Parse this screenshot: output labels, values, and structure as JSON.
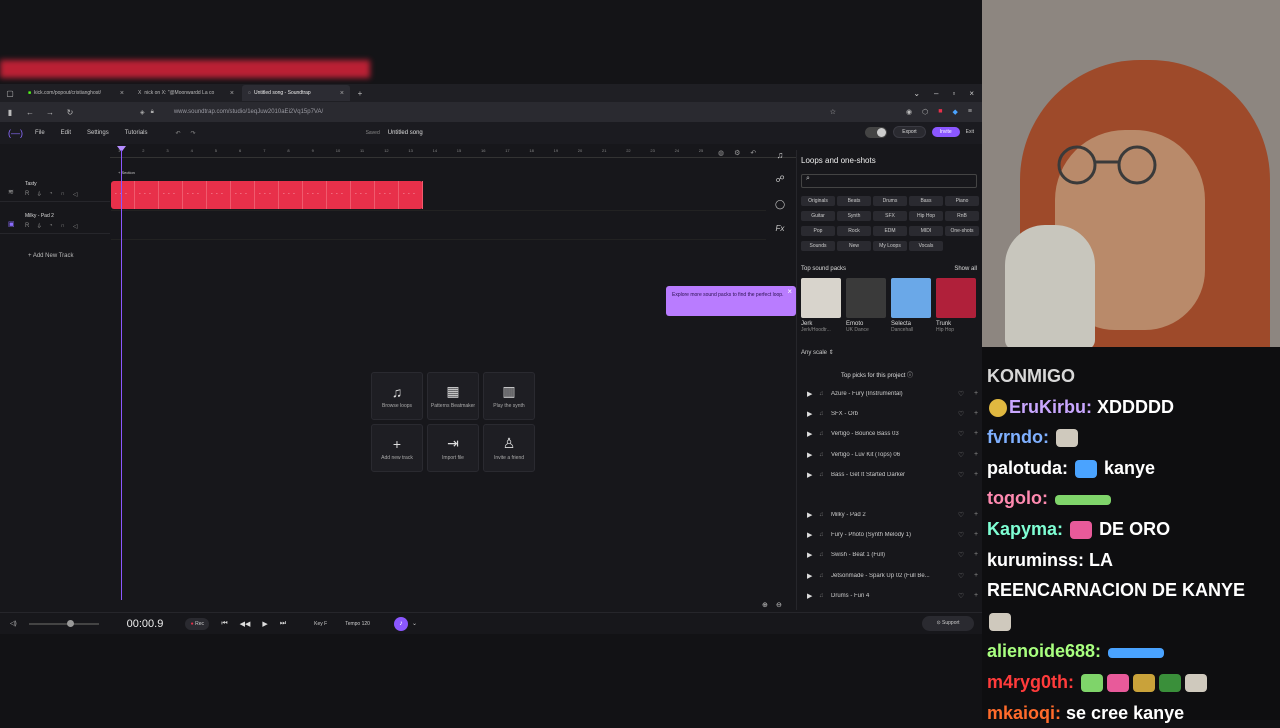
{
  "browser": {
    "tabs": [
      {
        "label": "kick.com/popout/cristianghost/",
        "active": false
      },
      {
        "label": "nick on X: \"@Moonwardd La co",
        "active": false
      },
      {
        "label": "Untitled song - Soundtrap",
        "active": true
      }
    ],
    "url": "www.soundtrap.com/studio/1eqJuw2010aEi2Vq15p7VA/"
  },
  "app": {
    "menu": [
      "File",
      "Edit",
      "Settings",
      "Tutorials"
    ],
    "saved_label": "Saved",
    "song_title": "Untitled song",
    "export_label": "Export",
    "invite_label": "Invite",
    "exit_label": "Exit"
  },
  "tracks": [
    {
      "name": "Tasty"
    },
    {
      "name": "Milky - Pad 2"
    }
  ],
  "add_track_label": "+ Add New Track",
  "section_label": "+ Section",
  "ruler_ticks": [
    "1",
    "2",
    "3",
    "4",
    "5",
    "6",
    "7",
    "8",
    "9",
    "10",
    "11",
    "12",
    "13",
    "14",
    "15",
    "16",
    "17",
    "18",
    "19",
    "20",
    "21",
    "22",
    "23",
    "24",
    "25"
  ],
  "empty_actions": [
    {
      "icon": "♫",
      "label": "Browse loops"
    },
    {
      "icon": "▦",
      "label": "Patterns Beatmaker"
    },
    {
      "icon": "▥",
      "label": "Play the synth"
    },
    {
      "icon": "+",
      "label": "Add new track"
    },
    {
      "icon": "⇥",
      "label": "Import file"
    },
    {
      "icon": "♙",
      "label": "Invite a friend"
    }
  ],
  "tooltip": {
    "text": "Explore more sound packs to find the perfect loop."
  },
  "loops": {
    "title": "Loops and one-shots",
    "search_placeholder": "",
    "filters": [
      "Originals",
      "Beats",
      "Drums",
      "Bass",
      "Piano",
      "Guitar",
      "Synth",
      "SFX",
      "Hip Hop",
      "RnB",
      "Pop",
      "Rock",
      "EDM",
      "MIDI",
      "One-shots",
      "Sounds",
      "New",
      "My Loops",
      "Vocals"
    ],
    "top_packs_label": "Top sound packs",
    "show_all_label": "Show all",
    "packs": [
      {
        "name": "Jerk",
        "genre": "Jerk/Hoodtr...",
        "color": "#d8d4cc"
      },
      {
        "name": "Emoto",
        "genre": "UK Dance",
        "color": "#3a3a3a"
      },
      {
        "name": "Selecta",
        "genre": "Dancehall",
        "color": "#6aa8e8"
      },
      {
        "name": "Trunk",
        "genre": "Hip Hop",
        "color": "#b0203a"
      }
    ],
    "any_scale_label": "Any scale",
    "top_picks_label": "Top picks for this project",
    "picks": [
      "Azure - Fury (Instrumental)",
      "SFX - Orb",
      "Vertigo - Bounce Bass 03",
      "Vertigo - Luv Kit (Tops) 06",
      "Bass - Get It Started Darker",
      "Milky - Pad 2",
      "Fury - Photo (Synth Melody 1)",
      "Swish - Beat 1 (Full)",
      "Jetsonmade - Spark Up 02 (Full Be...",
      "Drums - Fun 4"
    ]
  },
  "transport": {
    "time": "00:00.9",
    "rec_label": "Rec",
    "key_label": "Key F",
    "tempo_label": "Tempo 120",
    "support_label": "Support"
  },
  "chat": {
    "messages": [
      {
        "user": "KONMIGO",
        "color": "#d8d8d8",
        "text": "",
        "emotes": 0,
        "header": true
      },
      {
        "user": "EruKirbu:",
        "color": "#c9a7ff",
        "text": "XDDDDD",
        "emotes": 0,
        "badge": true
      },
      {
        "user": "fvrndo:",
        "color": "#7fb0ff",
        "text": "",
        "emotes": 1
      },
      {
        "user": "palotuda:",
        "color": "#ffffff",
        "text": "kanye",
        "emotes": 1
      },
      {
        "user": "togolo:",
        "color": "#ff8ab0",
        "text": "",
        "emotes": 1
      },
      {
        "user": "Kapyma:",
        "color": "#7fffd4",
        "text": "DE ORO",
        "emotes": 1
      },
      {
        "user": "kuruminss:",
        "color": "#ffffff",
        "text": "LA",
        "emotes": 0
      },
      {
        "user": "",
        "color": "#ffffff",
        "text": "REENCARNACION DE KANYE",
        "emotes": 0
      },
      {
        "user": "",
        "color": "#ffffff",
        "text": "",
        "emotes": 1
      },
      {
        "user": "alienoide688:",
        "color": "#a8ff7f",
        "text": "",
        "emotes": 1
      },
      {
        "user": "m4ryg0th:",
        "color": "#ff3b3b",
        "text": "",
        "emotes": 5
      },
      {
        "user": "mkaioqi:",
        "color": "#ff6b2b",
        "text": "se cree kanye",
        "emotes": 0
      }
    ]
  }
}
